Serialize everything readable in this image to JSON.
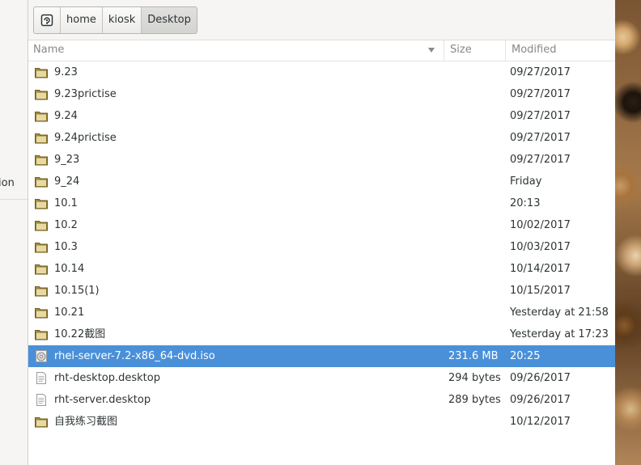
{
  "sidebar": {
    "partial_label": "ion"
  },
  "pathbar": {
    "crumbs": [
      {
        "label": "home",
        "active": false
      },
      {
        "label": "kiosk",
        "active": false
      },
      {
        "label": "Desktop",
        "active": true
      }
    ]
  },
  "columns": {
    "name": "Name",
    "size": "Size",
    "modified": "Modified"
  },
  "files": [
    {
      "name": "9.23",
      "size": "",
      "modified": "09/27/2017",
      "type": "folder"
    },
    {
      "name": "9.23prictise",
      "size": "",
      "modified": "09/27/2017",
      "type": "folder"
    },
    {
      "name": "9.24",
      "size": "",
      "modified": "09/27/2017",
      "type": "folder"
    },
    {
      "name": "9.24prictise",
      "size": "",
      "modified": "09/27/2017",
      "type": "folder"
    },
    {
      "name": "9_23",
      "size": "",
      "modified": "09/27/2017",
      "type": "folder"
    },
    {
      "name": "9_24",
      "size": "",
      "modified": "Friday",
      "type": "folder"
    },
    {
      "name": "10.1",
      "size": "",
      "modified": "20:13",
      "type": "folder"
    },
    {
      "name": "10.2",
      "size": "",
      "modified": "10/02/2017",
      "type": "folder"
    },
    {
      "name": "10.3",
      "size": "",
      "modified": "10/03/2017",
      "type": "folder"
    },
    {
      "name": "10.14",
      "size": "",
      "modified": "10/14/2017",
      "type": "folder"
    },
    {
      "name": "10.15(1)",
      "size": "",
      "modified": "10/15/2017",
      "type": "folder"
    },
    {
      "name": "10.21",
      "size": "",
      "modified": "Yesterday at 21:58",
      "type": "folder"
    },
    {
      "name": "10.22截图",
      "size": "",
      "modified": "Yesterday at 17:23",
      "type": "folder"
    },
    {
      "name": "rhel-server-7.2-x86_64-dvd.iso",
      "size": "231.6 MB",
      "modified": "20:25",
      "type": "disc-image",
      "selected": true
    },
    {
      "name": "rht-desktop.desktop",
      "size": "294 bytes",
      "modified": "09/26/2017",
      "type": "text-file"
    },
    {
      "name": "rht-server.desktop",
      "size": "289 bytes",
      "modified": "09/26/2017",
      "type": "text-file"
    },
    {
      "name": "自我练习截图",
      "size": "",
      "modified": "10/12/2017",
      "type": "folder"
    }
  ],
  "colors": {
    "selection": "#4a90d9",
    "folder": "#c4a000"
  },
  "icons": {
    "pathbar_toggle": "location-entry-icon",
    "sort": "sort-descending-icon"
  }
}
